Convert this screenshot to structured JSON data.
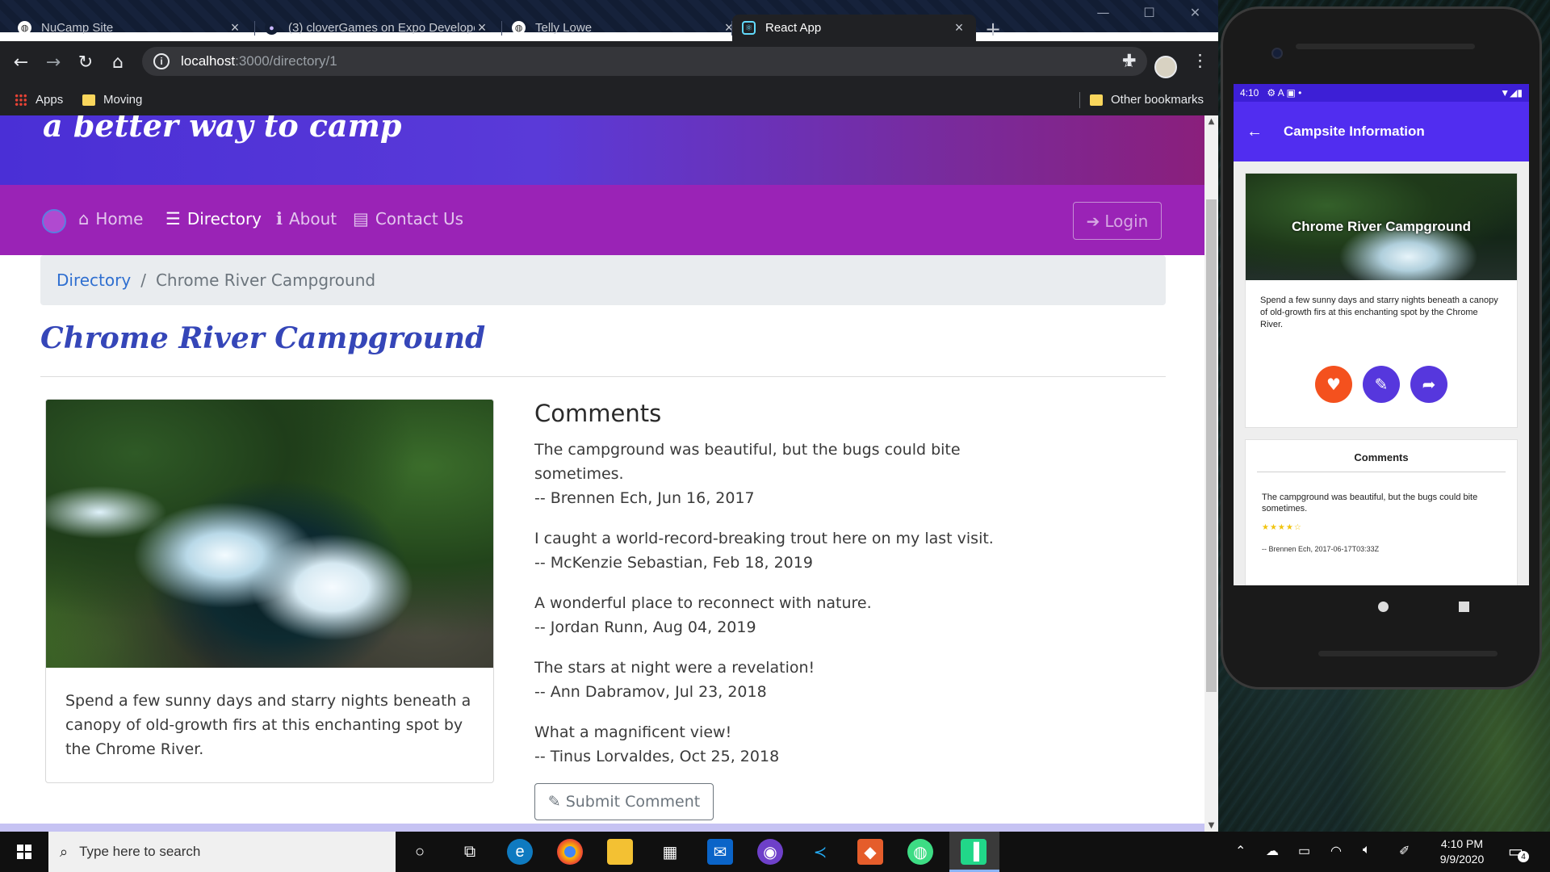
{
  "browser": {
    "tabs": [
      {
        "title": "NuCamp Site",
        "active": false
      },
      {
        "title": "(3) cloverGames on Expo Developer",
        "active": false
      },
      {
        "title": "Telly Lowe",
        "active": false
      },
      {
        "title": "React App",
        "active": true
      }
    ],
    "new_tab_label": "+",
    "url_host": "localhost",
    "url_path": ":3000/directory/1",
    "bookmarks": [
      {
        "label": "Apps",
        "icon": "apps-grid-icon"
      },
      {
        "label": "Moving",
        "icon": "folder-icon"
      }
    ],
    "other_bookmarks": "Other bookmarks"
  },
  "site": {
    "tagline": "a better way to camp",
    "nav": [
      {
        "label": "Home",
        "icon": "home-icon",
        "active": false
      },
      {
        "label": "Directory",
        "icon": "list-icon",
        "active": true
      },
      {
        "label": "About",
        "icon": "info-icon",
        "active": false
      },
      {
        "label": "Contact Us",
        "icon": "address-card-icon",
        "active": false
      }
    ],
    "login_label": "Login",
    "breadcrumb": {
      "link": "Directory",
      "separator": "/",
      "current": "Chrome River Campground"
    },
    "page_title": "Chrome River Campground",
    "campsite_description": "Spend a few sunny days and starry nights beneath a canopy of old-growth firs at this enchanting spot by the Chrome River.",
    "comments_heading": "Comments",
    "comments": [
      {
        "text": "The campground was beautiful, but the bugs could bite sometimes.",
        "byline": "-- Brennen Ech, Jun 16, 2017"
      },
      {
        "text": "I caught a world-record-breaking trout here on my last visit.",
        "byline": "-- McKenzie Sebastian, Feb 18, 2019"
      },
      {
        "text": "A wonderful place to reconnect with nature.",
        "byline": "-- Jordan Runn, Aug 04, 2019"
      },
      {
        "text": "The stars at night were a revelation!",
        "byline": "-- Ann Dabramov, Jul 23, 2018"
      },
      {
        "text": "What a magnificent view!",
        "byline": "-- Tinus Lorvaldes, Oct 25, 2018"
      }
    ],
    "submit_label": "Submit Comment"
  },
  "mobile": {
    "status_time": "4:10",
    "status_icons": "⚙ A ▣ •",
    "app_title": "Campsite Information",
    "card_title": "Chrome River Campground",
    "card_description": "Spend a few sunny days and starry nights beneath a canopy of old-growth firs at this enchanting spot by the Chrome River.",
    "buttons": [
      {
        "icon": "heart-icon",
        "color": "#f4511e"
      },
      {
        "icon": "pencil-icon",
        "color": "#5637dd"
      },
      {
        "icon": "share-icon",
        "color": "#5637dd"
      }
    ],
    "comments_heading": "Comments",
    "first_comment": {
      "text": "The campground was beautiful, but the bugs could bite sometimes.",
      "rating": 4,
      "byline": "-- Brennen Ech, 2017-06-17T03:33Z"
    }
  },
  "taskbar": {
    "search_placeholder": "Type here to search",
    "apps": [
      "task-view-icon",
      "edge-icon",
      "chrome-icon",
      "file-explorer-icon",
      "store-icon",
      "mail-icon",
      "github-desktop-icon",
      "vscode-icon",
      "sourcetree-icon",
      "android-studio-icon",
      "pycharm-icon"
    ],
    "time": "4:10 PM",
    "date": "9/9/2020",
    "notification_count": "4"
  },
  "colors": {
    "jumbotron_start": "#4a2fd6",
    "navbar": "#9a23b6",
    "title_blue": "#3546b8",
    "mobile_appbar": "#512df0"
  }
}
